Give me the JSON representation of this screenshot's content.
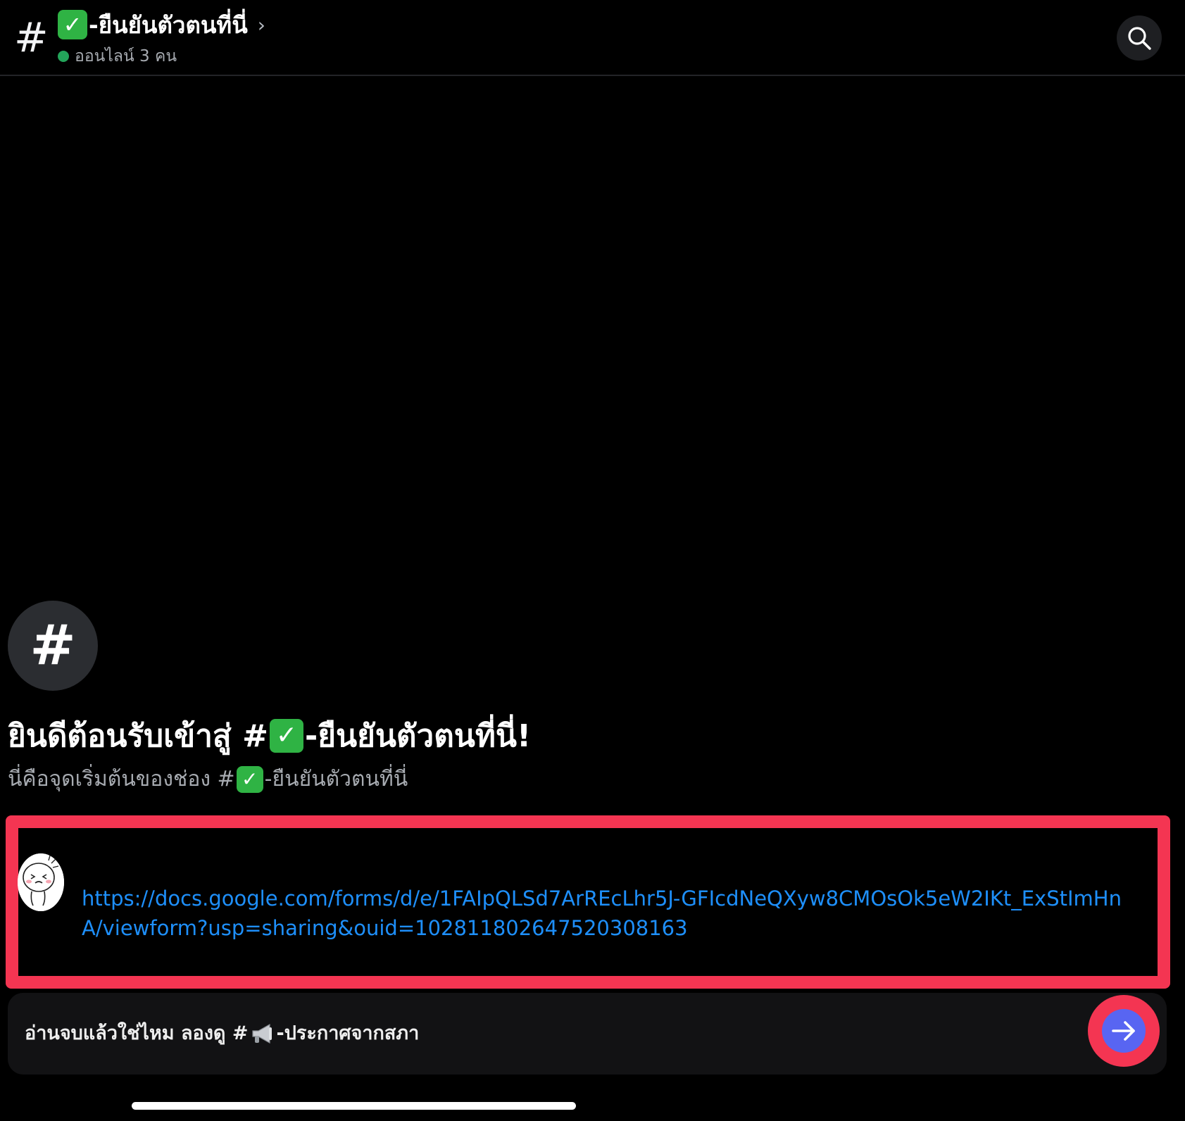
{
  "header": {
    "channel_symbol": "#",
    "check_glyph": "✓",
    "channel_name": "-ยืนยันตัวตนที่นี่",
    "chevron": "›",
    "online_status": "ออนไลน์ 3 คน",
    "search_icon": "search-icon"
  },
  "intro": {
    "avatar_symbol": "#",
    "welcome_prefix": "ยินดีต้อนรับเข้าสู่ #",
    "welcome_suffix": "-ยืนยันตัวตนที่นี่!",
    "subtitle_prefix": "นี่คือจุดเริ่มต้นของช่อง #",
    "subtitle_suffix": "-ยืนยันตัวตนที่นี่"
  },
  "message": {
    "link": "https://docs.google.com/forms/d/e/1FAIpQLSd7ArREcLhr5J-GFIcdNeQXyw8CMOsOk5eW2IKt_ExStImHnA/viewform?usp=sharing&ouid=102811802647520308163"
  },
  "bottom_bar": {
    "text_prefix": "อ่านจบแล้วใช่ไหม ลองดู #",
    "text_suffix": "-ประกาศจากสภา",
    "button_icon": "arrow-right-icon"
  },
  "colors": {
    "background": "#000000",
    "accent_blurple": "#5865f2",
    "highlight_red": "#f43552",
    "link_blue": "#1e8ffa",
    "online_green": "#23a55a",
    "check_green": "#2fb344"
  }
}
